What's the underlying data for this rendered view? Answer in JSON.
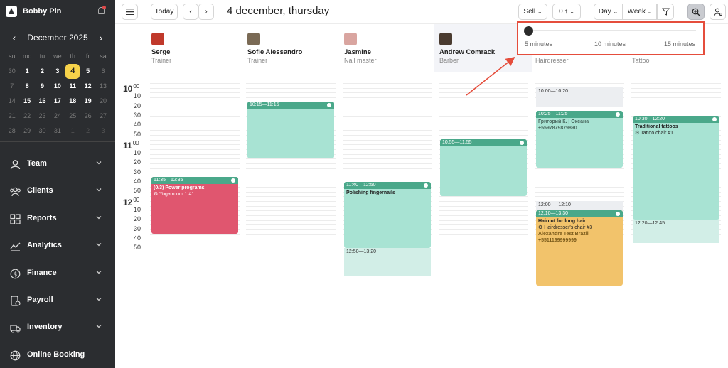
{
  "brand": {
    "name": "Bobby Pin"
  },
  "calendar": {
    "title": "December 2025",
    "weekdays": [
      "su",
      "mo",
      "tu",
      "we",
      "th",
      "fr",
      "sa"
    ],
    "weeks": [
      [
        {
          "d": "30",
          "m": 0
        },
        {
          "d": "1",
          "m": 1
        },
        {
          "d": "2",
          "m": 1
        },
        {
          "d": "3",
          "m": 1
        },
        {
          "d": "4",
          "m": 1,
          "sel": 1
        },
        {
          "d": "5",
          "m": 1
        },
        {
          "d": "6",
          "m": 0
        }
      ],
      [
        {
          "d": "7",
          "m": 0
        },
        {
          "d": "8",
          "m": 1
        },
        {
          "d": "9",
          "m": 1
        },
        {
          "d": "10",
          "m": 1
        },
        {
          "d": "11",
          "m": 1
        },
        {
          "d": "12",
          "m": 1
        },
        {
          "d": "13",
          "m": 0
        }
      ],
      [
        {
          "d": "14",
          "m": 0
        },
        {
          "d": "15",
          "m": 1
        },
        {
          "d": "16",
          "m": 1
        },
        {
          "d": "17",
          "m": 1
        },
        {
          "d": "18",
          "m": 1
        },
        {
          "d": "19",
          "m": 1
        },
        {
          "d": "20",
          "m": 0
        }
      ],
      [
        {
          "d": "21",
          "m": 0
        },
        {
          "d": "22",
          "m": 0
        },
        {
          "d": "23",
          "m": 0
        },
        {
          "d": "24",
          "m": 0
        },
        {
          "d": "25",
          "m": 0
        },
        {
          "d": "26",
          "m": 0
        },
        {
          "d": "27",
          "m": 0
        }
      ],
      [
        {
          "d": "28",
          "m": 0
        },
        {
          "d": "29",
          "m": 0
        },
        {
          "d": "30",
          "m": 0
        },
        {
          "d": "31",
          "m": 0
        },
        {
          "d": "1",
          "m": 0,
          "dim": 1
        },
        {
          "d": "2",
          "m": 0,
          "dim": 1
        },
        {
          "d": "3",
          "m": 0,
          "dim": 1
        }
      ]
    ]
  },
  "nav": [
    {
      "label": "Team",
      "icon": "person-icon"
    },
    {
      "label": "Clients",
      "icon": "people-icon"
    },
    {
      "label": "Reports",
      "icon": "grid-icon"
    },
    {
      "label": "Analytics",
      "icon": "chart-icon"
    },
    {
      "label": "Finance",
      "icon": "dollar-icon"
    },
    {
      "label": "Payroll",
      "icon": "payroll-icon"
    },
    {
      "label": "Inventory",
      "icon": "truck-icon"
    },
    {
      "label": "Online Booking",
      "icon": "globe-icon"
    }
  ],
  "toolbar": {
    "today": "Today",
    "date": "4 december, thursday",
    "sell": "Sell",
    "filter_count": "0",
    "view_day": "Day",
    "view_week": "Week"
  },
  "staff": [
    {
      "name": "Serge",
      "role": "Trainer",
      "avatar_color": "#c0392b"
    },
    {
      "name": "Sofie Alessandro",
      "role": "Trainer",
      "avatar_color": "#7a6a55"
    },
    {
      "name": "Jasmine",
      "role": "Nail master",
      "avatar_color": "#d9a5a0"
    },
    {
      "name": "Andrew Comrack",
      "role": "Barber",
      "avatar_color": "#4a3b30"
    },
    {
      "name": "",
      "role": "Hairdresser",
      "avatar_color": "#888888"
    },
    {
      "name": "",
      "role": "Tattoo",
      "avatar_color": "#888888"
    }
  ],
  "time_labels": [
    {
      "t": "10",
      "hour": 1
    },
    {
      "t": "10"
    },
    {
      "t": "20"
    },
    {
      "t": "30"
    },
    {
      "t": "40"
    },
    {
      "t": "50"
    },
    {
      "t": "11",
      "hour": 1
    },
    {
      "t": "10"
    },
    {
      "t": "20"
    },
    {
      "t": "30"
    },
    {
      "t": "40"
    },
    {
      "t": "50"
    },
    {
      "t": "12",
      "hour": 1
    },
    {
      "t": "10"
    },
    {
      "t": "20"
    },
    {
      "t": "30"
    },
    {
      "t": "40"
    },
    {
      "t": "50"
    }
  ],
  "hour_suffix": "00",
  "appointments": [
    {
      "col": 0,
      "start": "11:35",
      "end": "12:35",
      "time": "11:35—12:35",
      "bg": "#e0566f",
      "header": "#4aa88a",
      "icon": "group-icon",
      "title": "(0/3) Power programs",
      "title_color": "#fff",
      "sub": "Yoga room 1 #1",
      "sub_color": "#fff"
    },
    {
      "col": 1,
      "start": "10:15",
      "end": "11:15",
      "time": "10:15—11:15",
      "bg": "#a8e3d3",
      "header": "#4aa88a",
      "icon": "clock-icon"
    },
    {
      "col": 2,
      "start": "11:40",
      "end": "12:50",
      "time": "11:40—12:50",
      "bg": "#a8e3d3",
      "header": "#4aa88a",
      "icon": "clock-icon",
      "title": "Polishing fingernails"
    },
    {
      "col": 3,
      "start": "10:55",
      "end": "11:55",
      "time": "10:55—11:55",
      "bg": "#a8e3d3",
      "header": "#4aa88a",
      "icon": "clock-icon"
    },
    {
      "col": 4,
      "start": "10:25",
      "end": "11:25",
      "time": "10:25—11:25",
      "bg": "#a8e3d3",
      "header": "#4aa88a",
      "icon": "clock-icon",
      "title": "Григорий К. | Оксана",
      "title_color": "#4a6a60",
      "extra": "+5597879879890",
      "extra_color": "#4a6a60"
    },
    {
      "col": 4,
      "start": "12:10",
      "end": "13:30",
      "time": "12:10—13:30",
      "bg": "#f2c36b",
      "header": "#4aa88a",
      "icon": "clock-icon",
      "title": "Haircut for long hair",
      "sub": "Hairdresser's chair #3",
      "extra": "Alexandre Test Brazil",
      "extra_color": "#7a5a1a",
      "extra2": "+5511199999999",
      "extra2_color": "#7a5a1a"
    },
    {
      "col": 5,
      "start": "10:30",
      "end": "12:20",
      "time": "10:30—12:20",
      "bg": "#a8e3d3",
      "header": "#4aa88a",
      "icon": "clock-icon",
      "title": "Traditional tattoos",
      "sub": "Tattoo chair #1"
    }
  ],
  "blocked": [
    {
      "col": 4,
      "start": "10:00",
      "end": "10:20",
      "label": "10:00—10:20",
      "bg": "#eceef1"
    },
    {
      "col": 4,
      "start": "12:00",
      "end": "12:10",
      "label": "12:00 — 12:10",
      "bg": "#eceef1"
    },
    {
      "col": 5,
      "start": "12:20",
      "end": "12:45",
      "label": "12:20—12:45",
      "bg": "#d2eee7"
    },
    {
      "col": 2,
      "start": "12:50",
      "end": "13:20",
      "label": "12:50—13:20",
      "bg": "#d2eee7"
    }
  ],
  "zoom": {
    "labels": [
      "5 minutes",
      "10 minutes",
      "15 minutes"
    ],
    "value": "5 minutes",
    "value_fraction": 0
  }
}
